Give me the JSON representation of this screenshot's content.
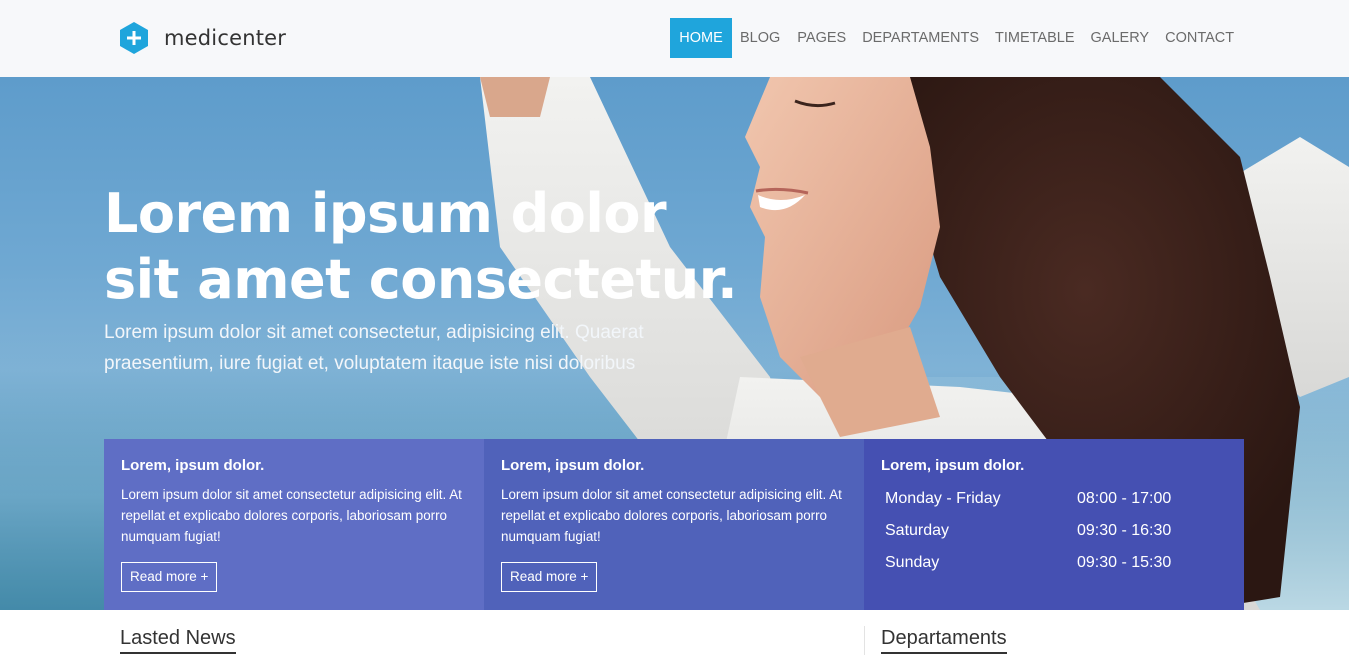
{
  "brand": {
    "name": "medicenter",
    "accent_color": "#1fa5dc"
  },
  "nav": {
    "items": [
      {
        "label": "HOME",
        "active": true
      },
      {
        "label": "BLOG",
        "active": false
      },
      {
        "label": "PAGES",
        "active": false
      },
      {
        "label": "DEPARTAMENTS",
        "active": false
      },
      {
        "label": "TIMETABLE",
        "active": false
      },
      {
        "label": "GALERY",
        "active": false
      },
      {
        "label": "CONTACT",
        "active": false
      }
    ]
  },
  "hero": {
    "title_line1": "Lorem ipsum dolor",
    "title_line2": "sit amet consectetur.",
    "subtitle_line1": "Lorem ipsum dolor sit amet consectetur, adipisicing elit. Quaerat",
    "subtitle_line2": "praesentium, iure fugiat et, voluptatem itaque iste nisi doloribus"
  },
  "boxes": [
    {
      "title": "Lorem, ipsum dolor.",
      "text": "Lorem ipsum dolor sit amet consectetur adipisicing elit. At repellat et explicabo dolores corporis, laboriosam porro numquam fugiat!",
      "button": "Read more +",
      "color": "#5f6ec5"
    },
    {
      "title": "Lorem, ipsum dolor.",
      "text": "Lorem ipsum dolor sit amet consectetur adipisicing elit. At repellat et explicabo dolores corporis, laboriosam porro numquam fugiat!",
      "button": "Read more +",
      "color": "#5062ba"
    },
    {
      "title": "Lorem, ipsum dolor.",
      "hours": [
        {
          "day": "Monday - Friday",
          "time": "08:00 - 17:00"
        },
        {
          "day": "Saturday",
          "time": "09:30 - 16:30"
        },
        {
          "day": "Sunday",
          "time": "09:30 - 15:30"
        }
      ],
      "color": "#4550b2"
    }
  ],
  "sections": {
    "news_title": "Lasted News",
    "departments_title": "Departaments"
  }
}
